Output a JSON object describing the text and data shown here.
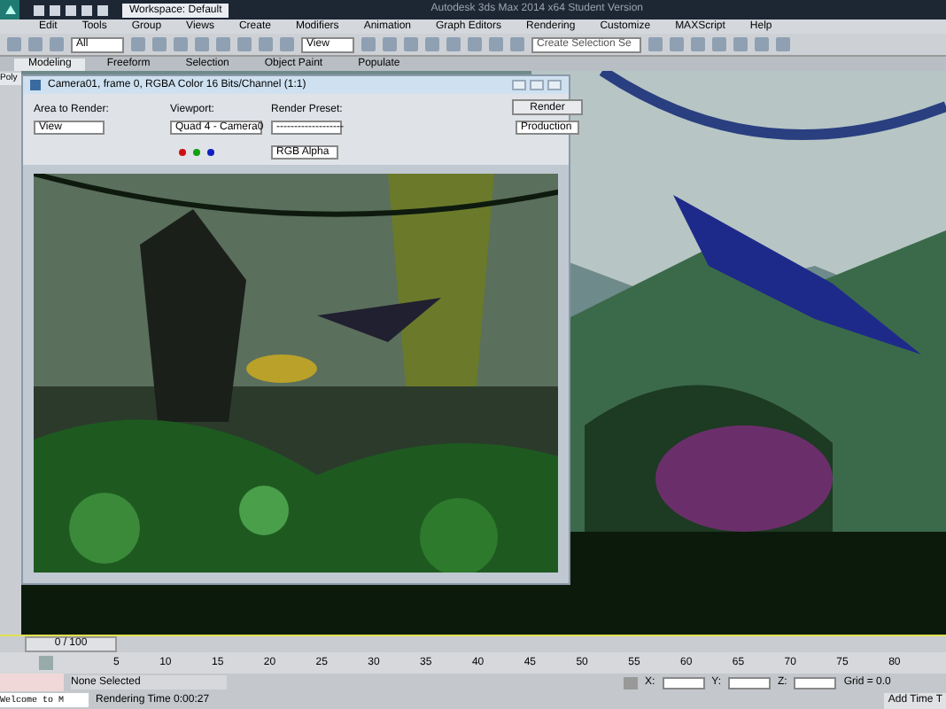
{
  "window": {
    "title": "Autodesk 3ds Max 2014 x64   Student Version"
  },
  "quick_access": {
    "workspace": "Workspace: Default"
  },
  "menu": [
    "Edit",
    "Tools",
    "Group",
    "Views",
    "Create",
    "Modifiers",
    "Animation",
    "Graph Editors",
    "Rendering",
    "Customize",
    "MAXScript",
    "Help"
  ],
  "toolbar": {
    "selection_filter": "All",
    "reference_coord": "View",
    "named_selection": "Create Selection Se"
  },
  "ribbon_tabs": [
    {
      "label": "Modeling",
      "selected": true
    },
    {
      "label": "Freeform",
      "selected": false
    },
    {
      "label": "Selection",
      "selected": false
    },
    {
      "label": "Object Paint",
      "selected": false
    },
    {
      "label": "Populate",
      "selected": false
    }
  ],
  "ribbon_label": "Poly",
  "render_window": {
    "title": "Camera01, frame 0, RGBA Color 16 Bits/Channel (1:1)",
    "area_label": "Area to Render:",
    "area": "View",
    "viewport_label": "Viewport:",
    "viewport": "Quad 4 - Camera0",
    "preset_label": "Render Preset:",
    "preset": "-------------------",
    "render_button": "Render",
    "mode": "Production",
    "channel": "RGB Alpha"
  },
  "time_slider": {
    "label": "0 / 100"
  },
  "ticks": [
    "5",
    "10",
    "15",
    "20",
    "25",
    "30",
    "35",
    "40",
    "45",
    "50",
    "55",
    "60",
    "65",
    "70",
    "75",
    "80"
  ],
  "status": {
    "selection": "None Selected",
    "render_time": "Rendering Time  0:00:27",
    "script_listener": "Welcome to M",
    "x_label": "X:",
    "y_label": "Y:",
    "z_label": "Z:",
    "grid": "Grid = 0.0",
    "add_time_tag": "Add Time T"
  }
}
